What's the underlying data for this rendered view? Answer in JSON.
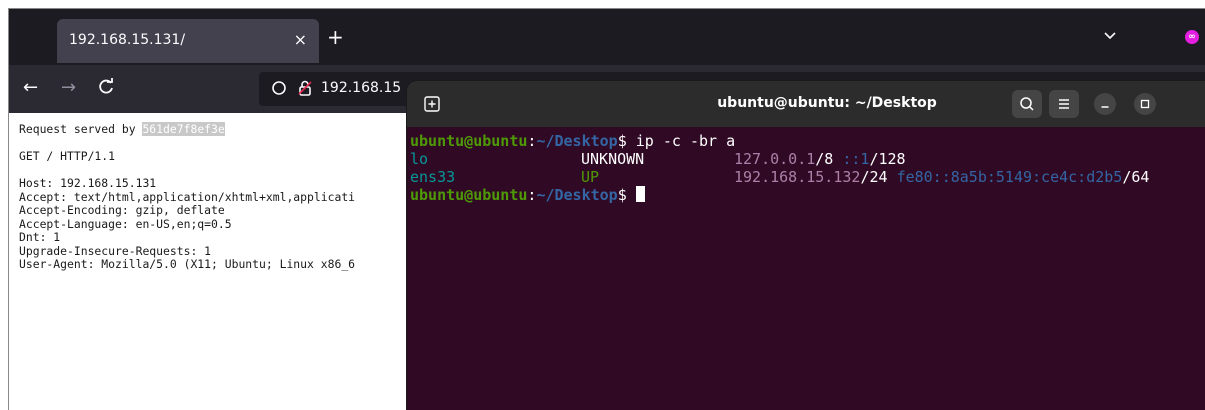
{
  "browser": {
    "tab_title": "192.168.15.131/",
    "tab_close": "×",
    "new_tab": "+",
    "url": "192.168.15",
    "extension_badge": "∞",
    "page": {
      "request_served_label": "Request served by ",
      "request_served_id": "561de7f8ef3e",
      "lines": [
        "",
        "GET / HTTP/1.1",
        "",
        "Host: 192.168.15.131",
        "Accept: text/html,application/xhtml+xml,applicati",
        "Accept-Encoding: gzip, deflate",
        "Accept-Language: en-US,en;q=0.5",
        "Dnt: 1",
        "Upgrade-Insecure-Requests: 1",
        "User-Agent: Mozilla/5.0 (X11; Ubuntu; Linux x86_6"
      ]
    }
  },
  "terminal": {
    "title": "ubuntu@ubuntu: ~/Desktop",
    "prompt_user": "ubuntu@ubuntu",
    "prompt_colon": ":",
    "prompt_path": "~/Desktop",
    "prompt_dollar": "$ ",
    "command": "ip -c -br a",
    "rows": [
      {
        "iface": "lo",
        "state": "UNKNOWN",
        "ip": "127.0.0.1",
        "ip_suffix": "/8 ",
        "ip6": "::1",
        "ip6_suffix": "/128"
      },
      {
        "iface": "ens33",
        "state": "UP",
        "ip": "192.168.15.132",
        "ip_suffix": "/24 ",
        "ip6": "fe80::8a5b:5149:ce4c:d2b5",
        "ip6_suffix": "/64"
      }
    ]
  },
  "colors": {
    "terminal_bg": "#300a24",
    "prompt_user": "#4e9a06",
    "prompt_path": "#3465a4",
    "ip_color": "#ad7fa8"
  }
}
